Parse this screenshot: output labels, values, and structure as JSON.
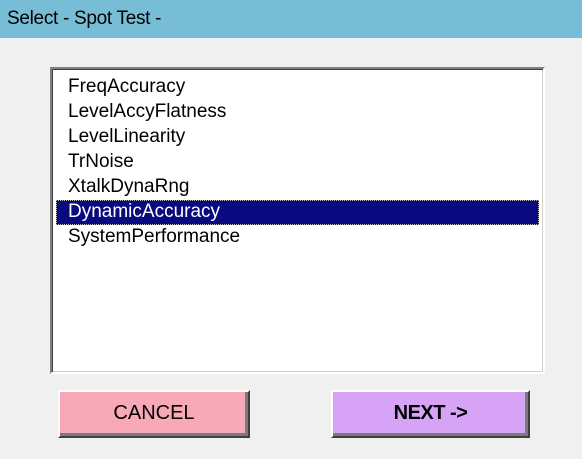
{
  "window": {
    "title": "Select - Spot Test -"
  },
  "list": {
    "items": [
      {
        "label": "FreqAccuracy",
        "selected": false
      },
      {
        "label": "LevelAccyFlatness",
        "selected": false
      },
      {
        "label": "LevelLinearity",
        "selected": false
      },
      {
        "label": "TrNoise",
        "selected": false
      },
      {
        "label": "XtalkDynaRng",
        "selected": false
      },
      {
        "label": "DynamicAccuracy",
        "selected": true
      },
      {
        "label": "SystemPerformance",
        "selected": false
      }
    ]
  },
  "buttons": {
    "cancel_label": "CANCEL",
    "next_label": "NEXT ->"
  },
  "colors": {
    "titlebar": "#78bdd6",
    "selection": "#0a0a80",
    "cancel_button": "#f7a9b8",
    "next_button": "#d6a3f7",
    "background": "#f0f0f0"
  }
}
